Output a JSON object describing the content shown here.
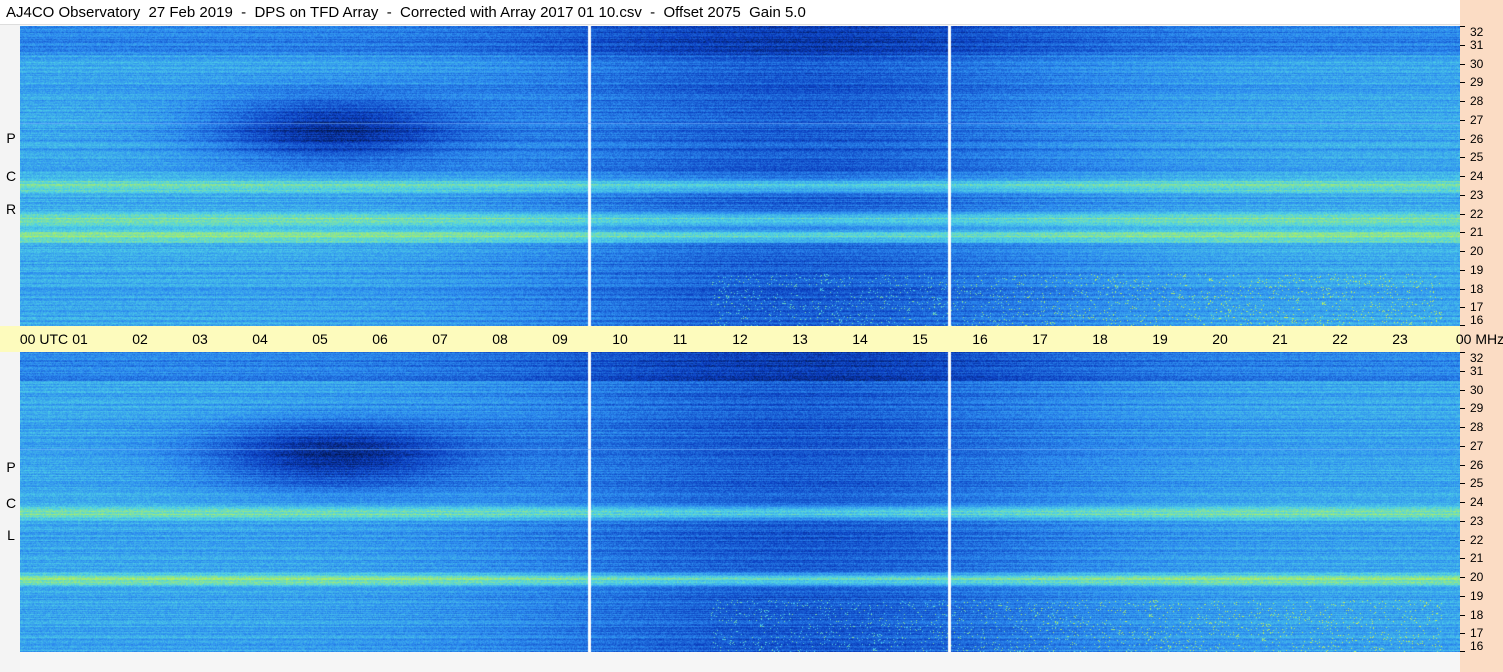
{
  "title": "AJ4CO Observatory  27 Feb 2019  -  DPS on TFD Array  -  Corrected with Array 2017 01 10.csv  -  Offset 2075  Gain 5.0",
  "panels": [
    {
      "polarization_label": [
        "R",
        "C",
        "P"
      ]
    },
    {
      "polarization_label": [
        "L",
        "C",
        "P"
      ]
    }
  ],
  "utc_axis": {
    "labels": [
      "00 UTC",
      "01",
      "02",
      "03",
      "04",
      "05",
      "06",
      "07",
      "08",
      "09",
      "10",
      "11",
      "12",
      "13",
      "14",
      "15",
      "16",
      "17",
      "18",
      "19",
      "20",
      "21",
      "22",
      "23",
      "00 MHz"
    ]
  },
  "colors": {
    "background": "#f6f6f6",
    "utc_bar": "#fdfbbd",
    "mhz_strip": "#fbdcc4",
    "data_gap_line": "#ffffff"
  },
  "chart_data": {
    "type": "heatmap",
    "title": "AJ4CO Observatory  27 Feb 2019  -  DPS on TFD Array  -  Corrected with Array 2017 01 10.csv  -  Offset 2075  Gain 5.0",
    "x": {
      "unit": "UTC hour",
      "range": [
        0,
        24
      ],
      "ticks": [
        "00",
        "01",
        "02",
        "03",
        "04",
        "05",
        "06",
        "07",
        "08",
        "09",
        "10",
        "11",
        "12",
        "13",
        "14",
        "15",
        "16",
        "17",
        "18",
        "19",
        "20",
        "21",
        "22",
        "23",
        "00"
      ]
    },
    "y": {
      "unit": "MHz",
      "range": [
        16,
        32
      ],
      "ticks": [
        32,
        31,
        30,
        29,
        28,
        27,
        26,
        25,
        24,
        23,
        22,
        21,
        20,
        19,
        18,
        17,
        16
      ]
    },
    "panels": [
      "RCP",
      "LCP"
    ],
    "data_gaps_utc": [
      9.5,
      15.5
    ],
    "bright_bands_mhz": {
      "RCP": [
        23.5,
        21.7,
        20.8
      ],
      "LCP": [
        23.5,
        19.9
      ]
    },
    "colormap": [
      "#000a28",
      "#0a3cbe",
      "#2d8cf0",
      "#50d2e6",
      "#b4f05a",
      "#ffff3c"
    ]
  }
}
